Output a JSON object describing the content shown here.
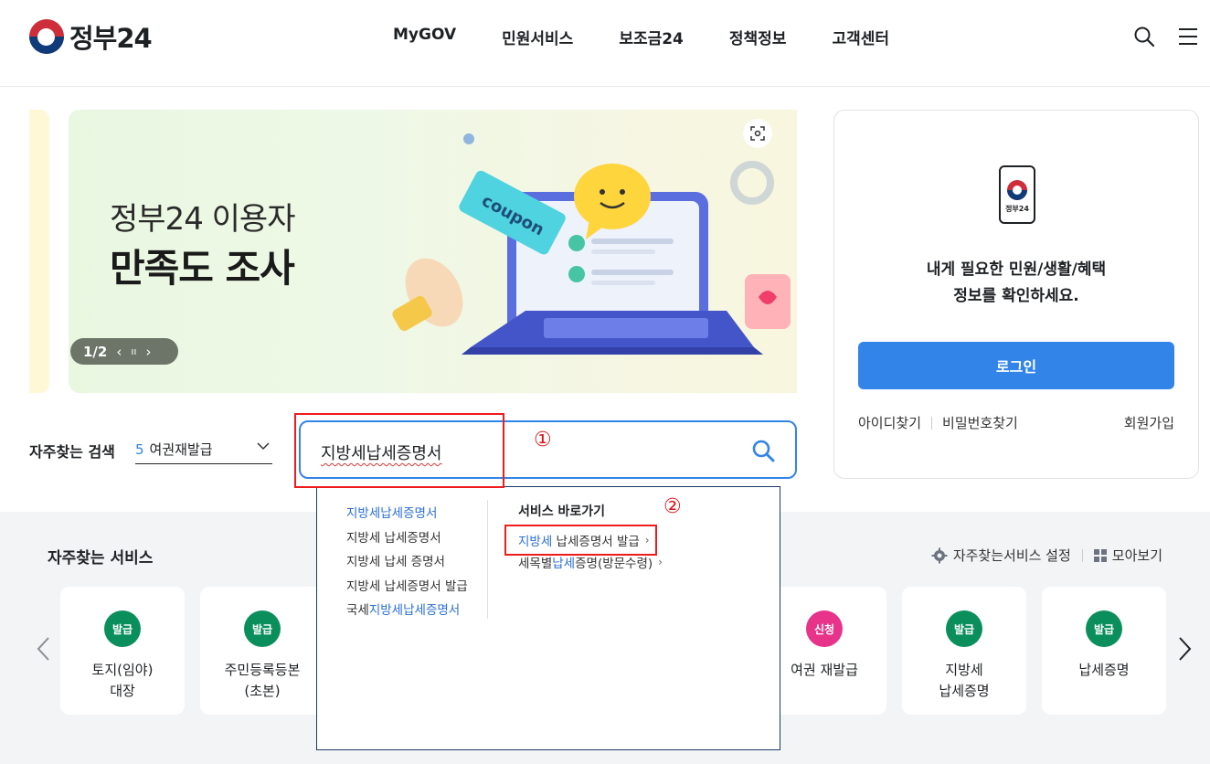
{
  "header": {
    "logo_text": "정부24",
    "nav": [
      "MyGOV",
      "민원서비스",
      "보조금24",
      "정책정보",
      "고객센터"
    ],
    "search_icon": "search-icon",
    "menu_icon": "hamburger-menu-icon"
  },
  "banner": {
    "title_line1": "정부24 이용자",
    "title_line2": "만족도 조사",
    "page_indicator": "1/2",
    "prev": "‹",
    "pause": "ıı",
    "next": "›",
    "illustration_text": "coupon"
  },
  "login": {
    "phone_label": "정부24",
    "message_line1": "내게 필요한 민원/생활/혜택",
    "message_line2": "정보를 확인하세요.",
    "login_button": "로그인",
    "find_id": "아이디찾기",
    "find_password": "비밀번호찾기",
    "signup": "회원가입"
  },
  "frequent_search": {
    "label": "자주찾는 검색",
    "selected_number": "5",
    "selected_text": "여권재발급"
  },
  "search": {
    "value": "지방세납세증명서"
  },
  "annotations": {
    "marker1": "①",
    "marker2": "②",
    "highlight_color": "#ee1c1c"
  },
  "autocomplete": {
    "suggestions": [
      {
        "pre": "",
        "hl": "지방세납세증명서",
        "post": ""
      },
      {
        "pre": "지방세 납세증명서",
        "hl": "",
        "post": ""
      },
      {
        "pre": "지방세 납세 증명서",
        "hl": "",
        "post": ""
      },
      {
        "pre": "지방세 납세증명서 발급",
        "hl": "",
        "post": ""
      },
      {
        "pre": "국세",
        "hl": "지방세납세증명서",
        "post": ""
      }
    ],
    "shortcut_heading": "서비스 바로가기",
    "shortcuts": [
      {
        "pre": "",
        "hl": "지방세",
        "post": " 납세증명서 발급"
      },
      {
        "pre": "세목별",
        "hl": "납세",
        "post": "증명(방문수령)"
      }
    ]
  },
  "services": {
    "title": "자주찾는 서비스",
    "settings_label": "자주찾는서비스 설정",
    "view_all_label": "모아보기",
    "cards": [
      {
        "badge": "발급",
        "badge_color": "#0a8f5c",
        "label": "토지(임야)\n대장"
      },
      {
        "badge": "발급",
        "badge_color": "#0a8f5c",
        "label": "주민등록등본\n(초본)"
      },
      {
        "badge": "신청",
        "badge_color": "#e8338a",
        "label": "여권 재발급"
      },
      {
        "badge": "발급",
        "badge_color": "#0a8f5c",
        "label": "지방세\n납세증명"
      },
      {
        "badge": "발급",
        "badge_color": "#0a8f5c",
        "label": "납세증명"
      }
    ]
  },
  "colors": {
    "primary": "#3384e8",
    "link_highlight": "#2a6fd6",
    "badge_green": "#0a8f5c",
    "badge_pink": "#e8338a"
  }
}
